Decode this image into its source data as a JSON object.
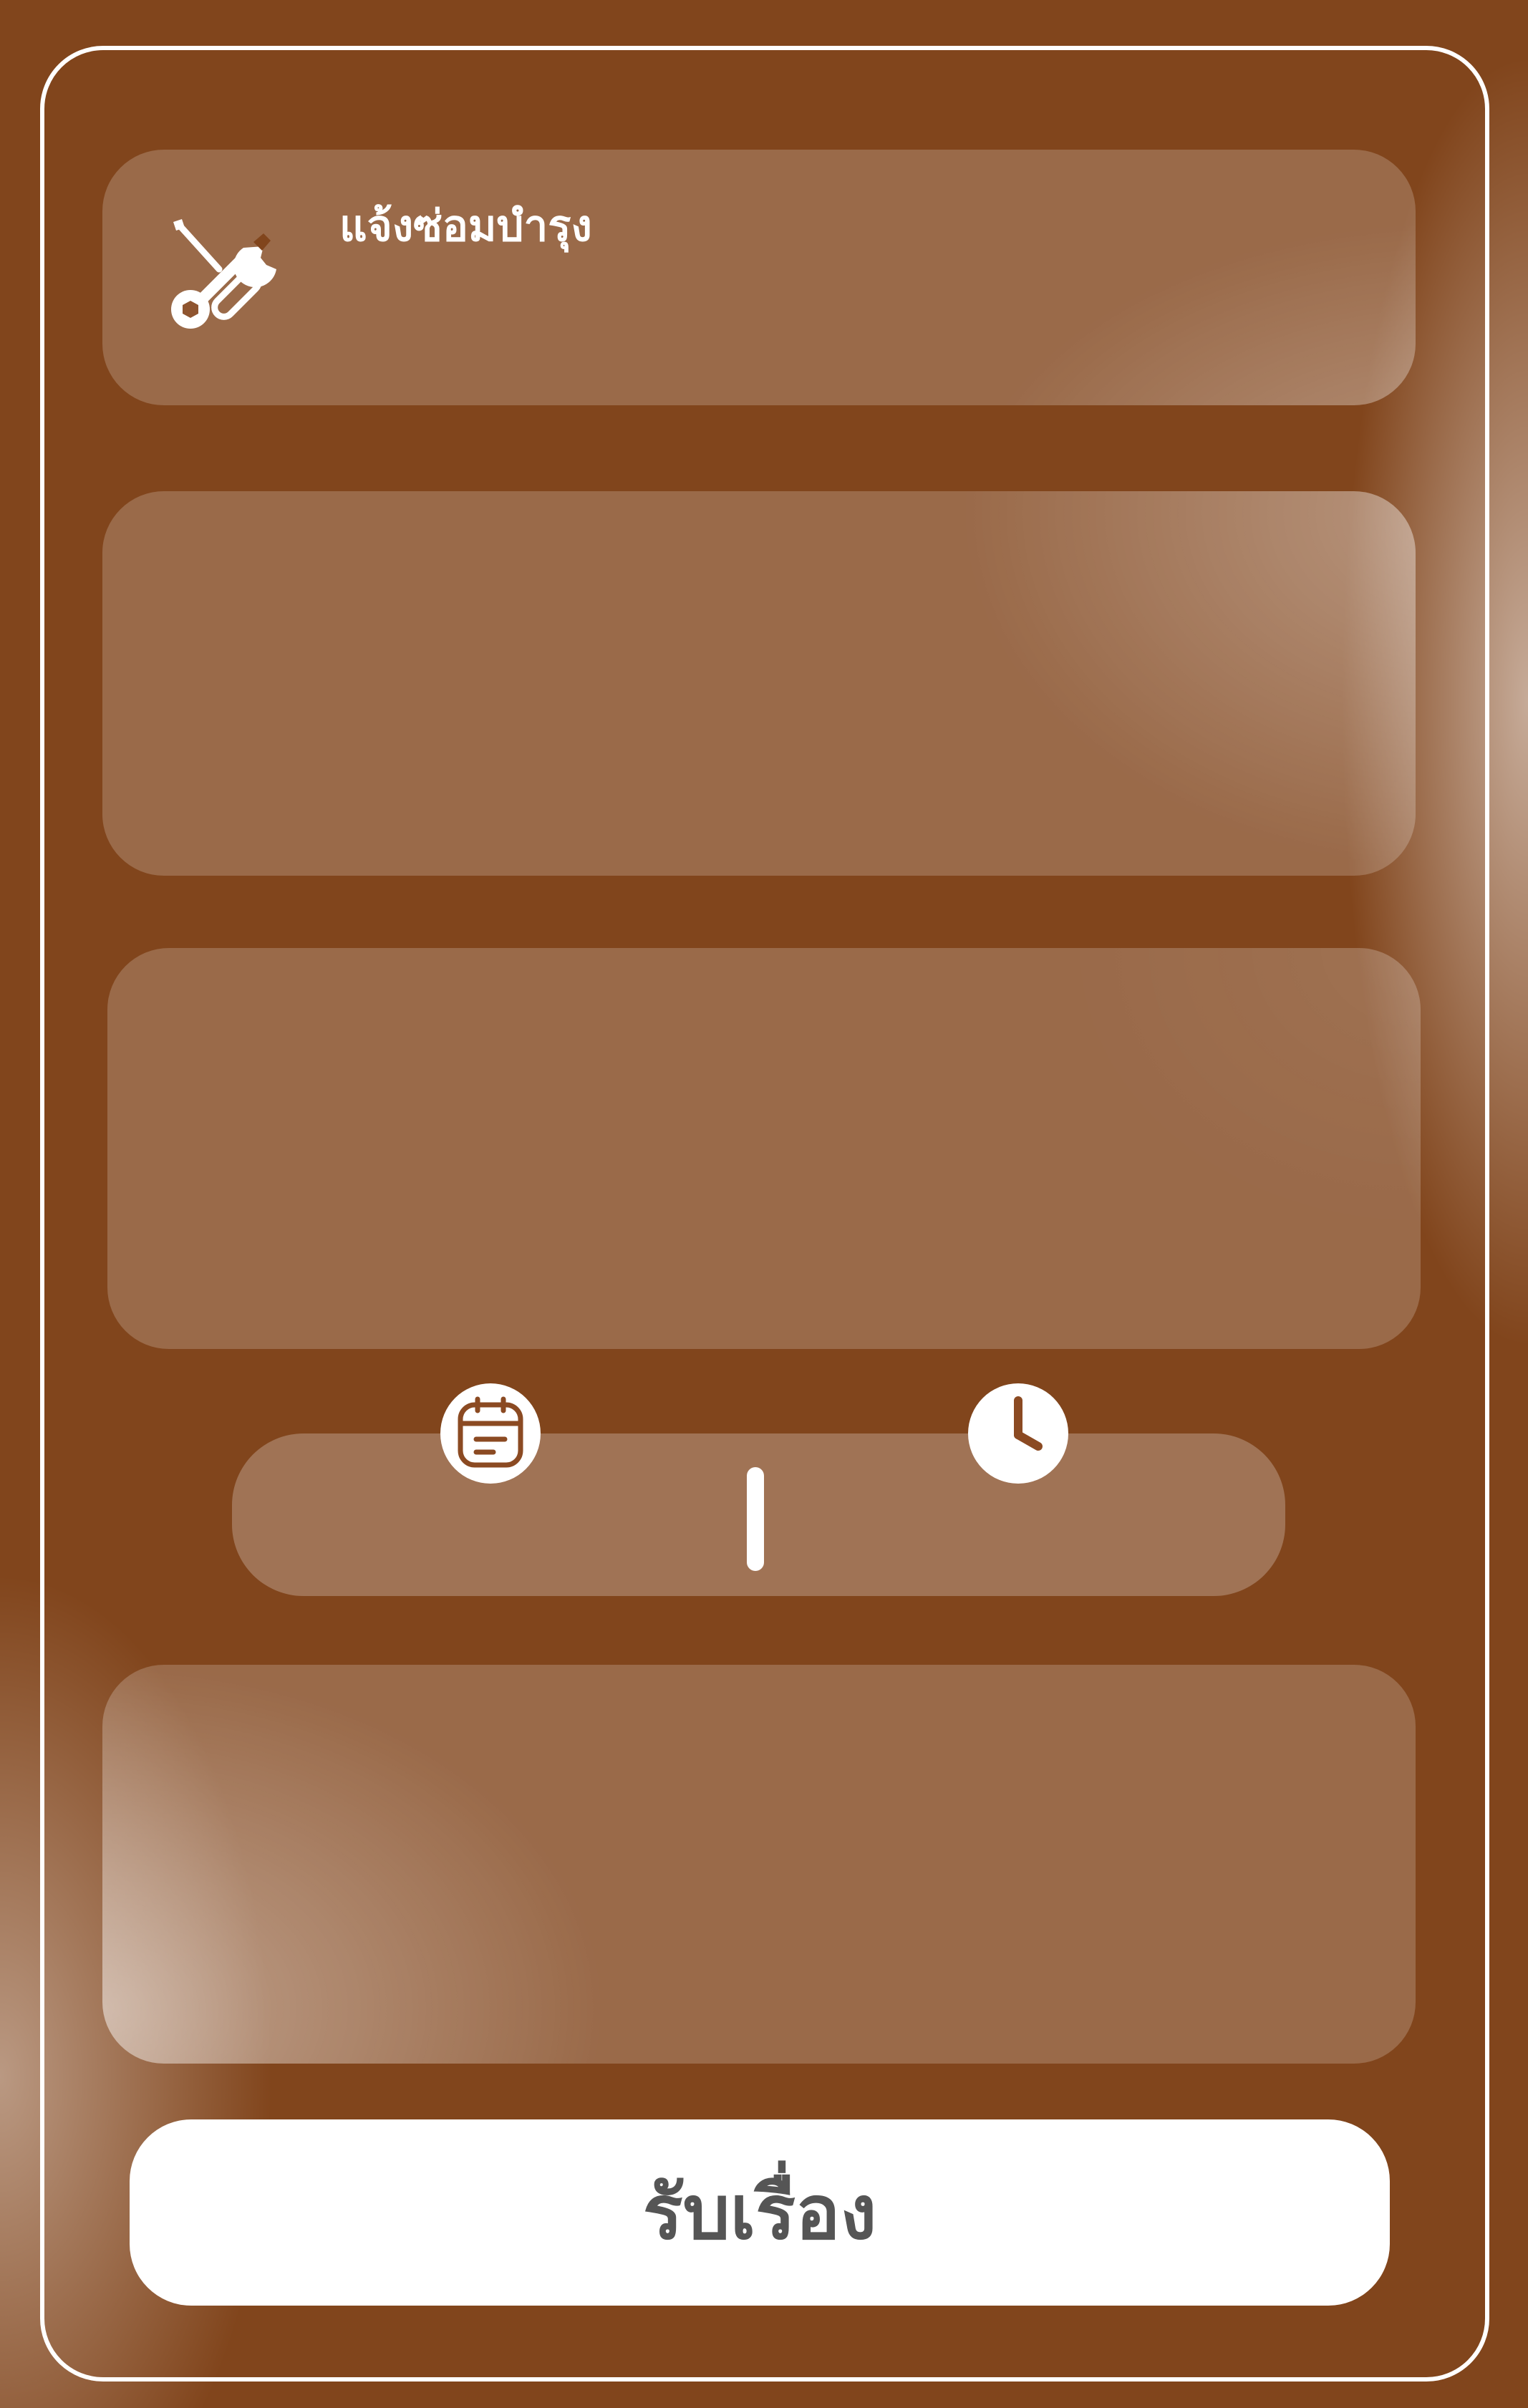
{
  "header": {
    "title": "แจ้งซ่อมบำรุง",
    "icon": "tools-icon"
  },
  "datetime": {
    "date_icon": "calendar-icon",
    "time_icon": "clock-icon"
  },
  "actions": {
    "accept_label": "รับเรื่อง"
  },
  "colors": {
    "background": "#81451c",
    "panel": "rgba(255,255,255,0.2)",
    "frame_border": "#ffffff",
    "button_background": "#ffffff",
    "button_text": "#555555",
    "icon_accent": "#8b4a22"
  }
}
